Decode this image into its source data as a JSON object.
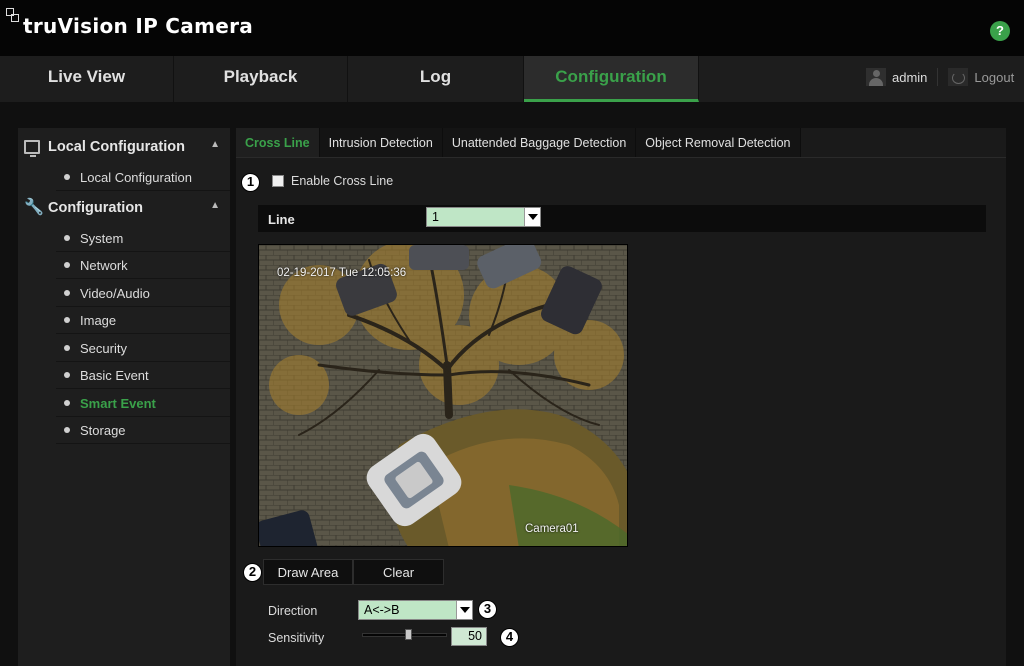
{
  "app": {
    "brand": "truVision  IP Camera",
    "help_symbol": "?"
  },
  "nav": {
    "tabs": [
      {
        "label": "Live View"
      },
      {
        "label": "Playback"
      },
      {
        "label": "Log"
      },
      {
        "label": "Configuration",
        "active": true
      }
    ],
    "user": "admin",
    "logout": "Logout"
  },
  "sidebar": {
    "sections": [
      {
        "label": "Local Configuration",
        "items": [
          "Local Configuration"
        ]
      },
      {
        "label": "Configuration",
        "items": [
          "System",
          "Network",
          "Video/Audio",
          "Image",
          "Security",
          "Basic Event",
          "Smart Event",
          "Storage"
        ],
        "active_item": "Smart Event"
      }
    ]
  },
  "subtabs": [
    {
      "label": "Cross Line",
      "active": true
    },
    {
      "label": "Intrusion Detection"
    },
    {
      "label": "Unattended Baggage Detection"
    },
    {
      "label": "Object Removal Detection"
    }
  ],
  "callouts": [
    "1",
    "2",
    "3",
    "4"
  ],
  "form": {
    "enable_label": "Enable Cross Line",
    "enabled": false,
    "line_label": "Line",
    "line_value": "1",
    "camera": {
      "timestamp": "02-19-2017 Tue 12:05:36",
      "name": "Camera01"
    },
    "draw_area": "Draw Area",
    "clear": "Clear",
    "direction_label": "Direction",
    "direction_value": "A<->B",
    "sensitivity_label": "Sensitivity",
    "sensitivity_value": "50",
    "sensitivity_level": 0.5
  },
  "colors": {
    "accent": "#3aa14a",
    "select_bg": "#bfe6c6"
  }
}
